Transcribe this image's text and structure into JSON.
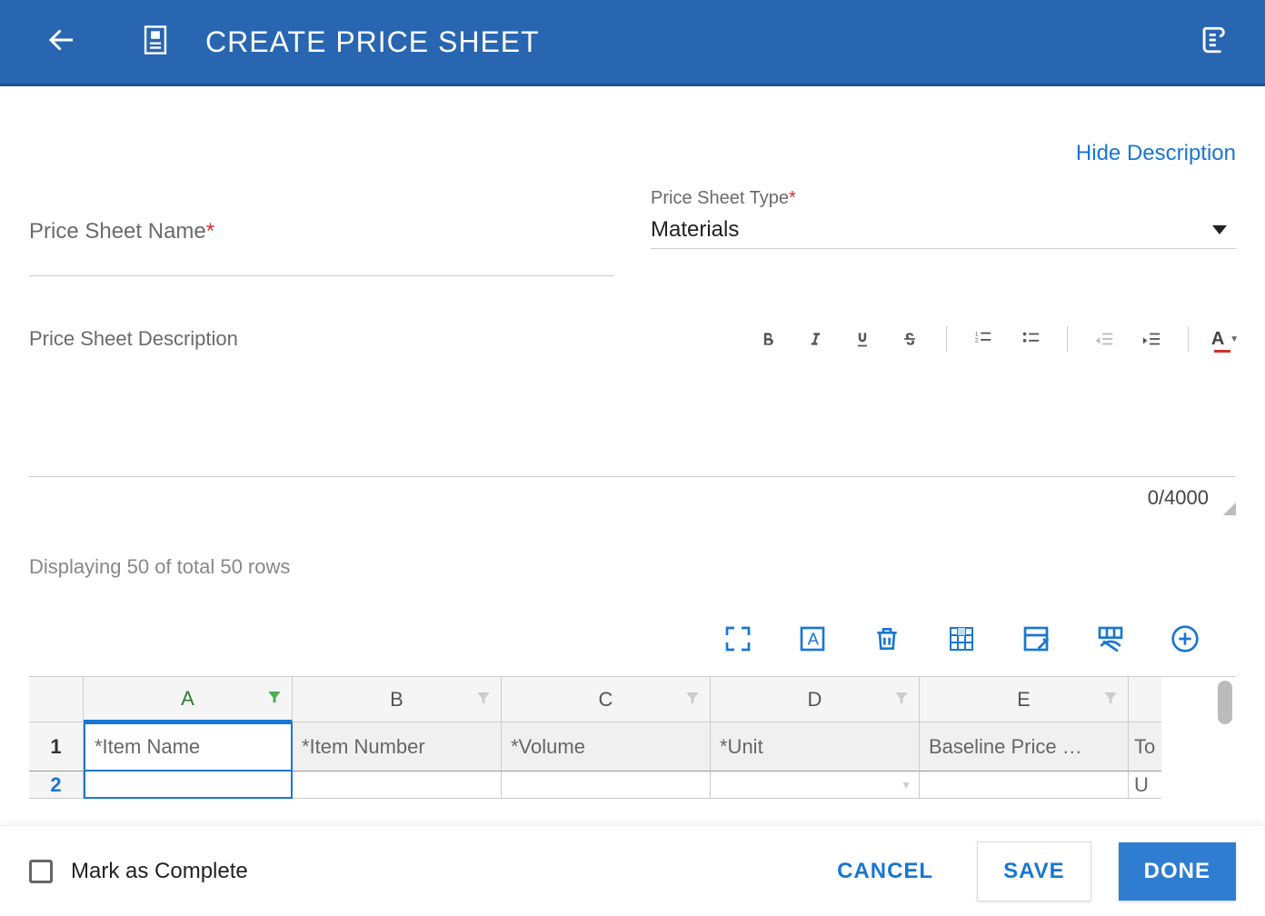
{
  "header": {
    "title": "CREATE PRICE SHEET"
  },
  "actions": {
    "hide_description": "Hide Description"
  },
  "form": {
    "name_label": "Price Sheet Name",
    "name_value": "",
    "type_label": "Price Sheet Type",
    "type_value": "Materials",
    "desc_label": "Price Sheet Description",
    "char_count": "0/4000"
  },
  "grid": {
    "rows_info": "Displaying 50 of total 50 rows",
    "columns": [
      "A",
      "B",
      "C",
      "D",
      "E"
    ],
    "row1": {
      "num": "1",
      "cells": [
        "*Item Name",
        "*Item Number",
        "*Volume",
        "*Unit",
        "Baseline Price …"
      ],
      "partial": "To"
    },
    "row2": {
      "num": "2",
      "partial": "U"
    }
  },
  "footer": {
    "complete_label": "Mark as Complete",
    "cancel": "CANCEL",
    "save": "SAVE",
    "done": "DONE"
  }
}
